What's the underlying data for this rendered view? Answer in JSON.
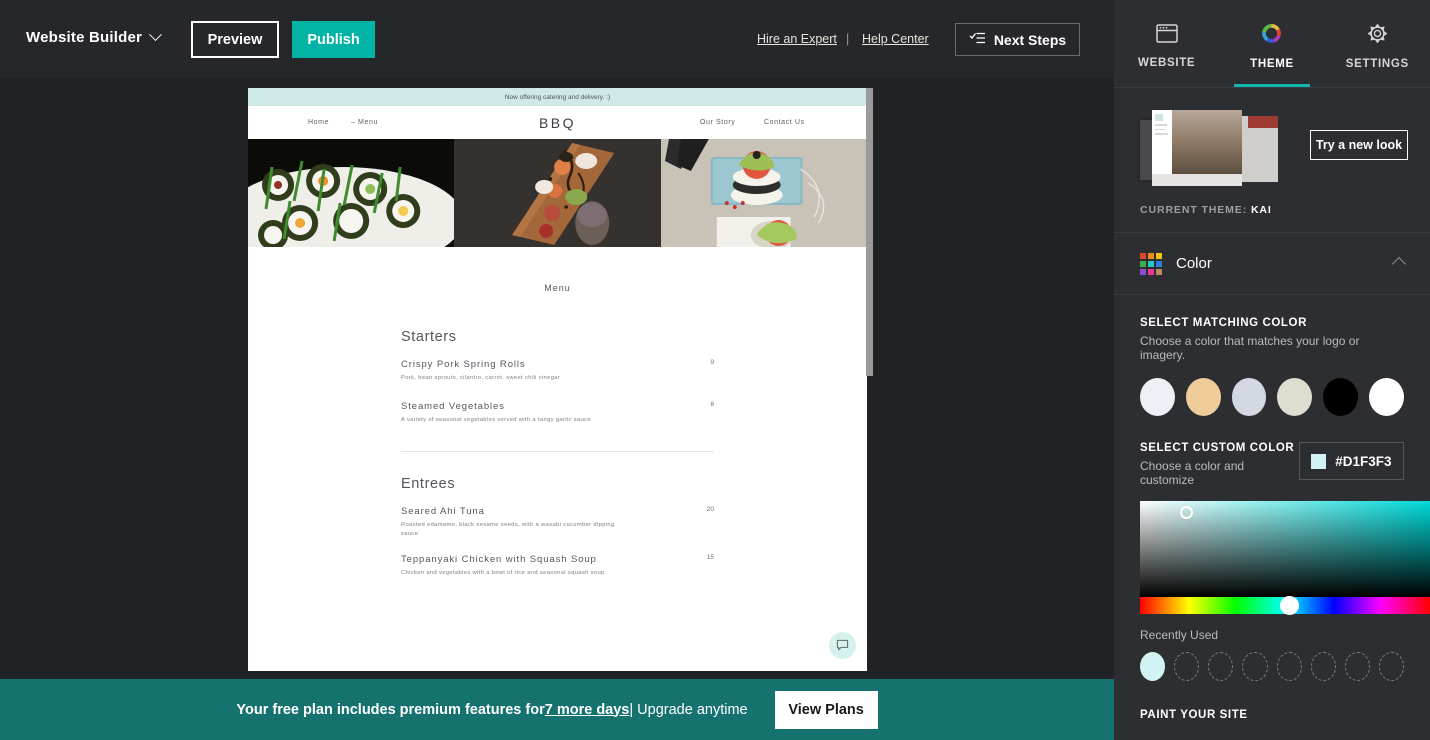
{
  "toolbar": {
    "brand": "Website Builder",
    "brand_icon": "chevron-down-icon",
    "preview_label": "Preview",
    "publish_label": "Publish",
    "hire_label": "Hire an Expert",
    "separator": "|",
    "help_label": "Help Center",
    "next_steps_label": "Next Steps",
    "next_steps_icon": "checklist-icon",
    "publish_color": "#00B3A4"
  },
  "preview": {
    "announcement": "Now offering catering and delivery. :)",
    "nav": {
      "home": "Home",
      "menu": "– Menu",
      "logo": "BBQ",
      "our_story": "Our Story",
      "contact": "Contact Us"
    },
    "banner_color": "#CFE9E6",
    "page_title": "Menu",
    "sections": [
      {
        "heading": "Starters",
        "items": [
          {
            "name": "Crispy Pork Spring Rolls",
            "desc": "Pork, bean sprouts, cilantro, carrot, sweet chili vinegar",
            "price": "9"
          },
          {
            "name": "Steamed Vegetables",
            "desc": "A variety of seasonal vegetables served with a tangy garlic sauce",
            "price": "8"
          }
        ]
      },
      {
        "heading": "Entrees",
        "items": [
          {
            "name": "Seared Ahi Tuna",
            "desc": "Roasted edamame, black sesame seeds, with a wasabi cucumber dipping sauce",
            "price": "20"
          },
          {
            "name": "Teppanyaki Chicken with Squash Soup",
            "desc": "Chicken and vegetables with a bowl of rice and seasonal squash soup",
            "price": "15"
          }
        ]
      }
    ],
    "chat_icon": "chat-bubble-icon"
  },
  "promo": {
    "text_before": "Your free plan includes premium features for ",
    "days_link": "7 more days",
    "text_after": " | Upgrade anytime",
    "view_plans_label": "View Plans",
    "background": "#15726F"
  },
  "sidebar": {
    "tabs": [
      {
        "label": "WEBSITE",
        "icon": "browser-window-icon",
        "active": false
      },
      {
        "label": "THEME",
        "icon": "color-wheel-icon",
        "active": true
      },
      {
        "label": "SETTINGS",
        "icon": "gear-icon",
        "active": false
      }
    ],
    "active_accent": "#12B5B0",
    "theme": {
      "try_new_look_label": "Try a new look",
      "current_theme_label": "CURRENT THEME:",
      "current_theme_name": "KAI"
    },
    "color": {
      "section_title": "Color",
      "section_icon": "color-grid-icon",
      "collapse_icon": "chevron-up-icon",
      "matching_label": "SELECT MATCHING COLOR",
      "matching_sub": "Choose a color that matches your logo or imagery.",
      "matching_swatches": [
        "#EEF0F5",
        "#F0CC9B",
        "#D4D8E2",
        "#DFDCD0",
        "#010101",
        "#FFFFFF"
      ],
      "custom_label": "SELECT CUSTOM COLOR",
      "custom_sub": "Choose a color and customize",
      "custom_hex": "#D1F3F3",
      "recent_label": "Recently Used",
      "recent_swatches": [
        "#D1F3F3",
        "",
        "",
        "",
        "",
        "",
        "",
        ""
      ],
      "paint_label": "PAINT YOUR SITE"
    }
  }
}
